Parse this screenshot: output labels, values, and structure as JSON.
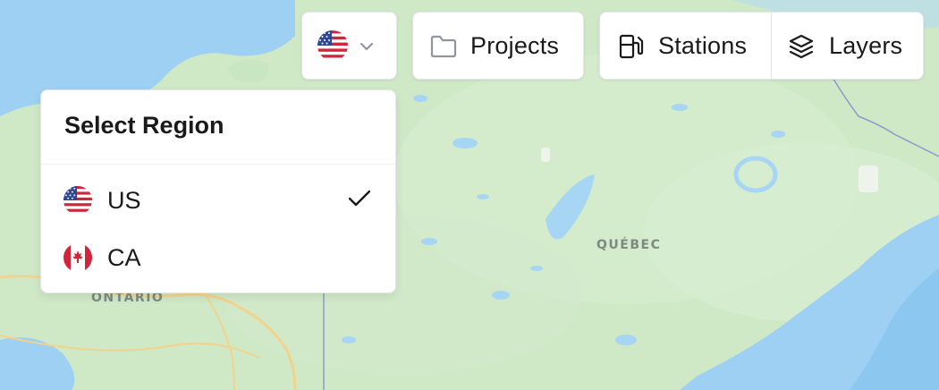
{
  "map": {
    "labels": {
      "quebec": "QUÉBEC",
      "ontario": "ONTARIO"
    },
    "colors": {
      "land": "#cfe8c6",
      "water": "#9dd0f2",
      "lake": "#a7d5f4",
      "border": "#8e9bcb",
      "road": "#f2d38c"
    }
  },
  "toolbar": {
    "region_button": {
      "selected": "US",
      "icon": "us-flag-icon",
      "chevron": "chevron-down-icon"
    },
    "projects": {
      "label": "Projects",
      "icon": "folder-icon"
    },
    "stations": {
      "label": "Stations",
      "icon": "fuel-pump-icon"
    },
    "layers": {
      "label": "Layers",
      "icon": "layers-icon"
    }
  },
  "region_dropdown": {
    "title": "Select Region",
    "options": [
      {
        "code": "US",
        "label": "US",
        "icon": "us-flag-icon",
        "selected": true
      },
      {
        "code": "CA",
        "label": "CA",
        "icon": "ca-flag-icon",
        "selected": false
      }
    ],
    "check_icon": "check-icon"
  }
}
